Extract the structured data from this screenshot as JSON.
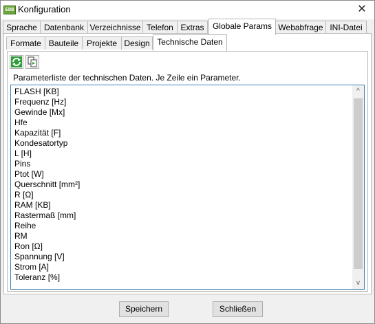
{
  "window": {
    "app_icon": "app-logo-icon",
    "title": "Konfiguration",
    "close_glyph": "✕"
  },
  "tabs": [
    "Sprache",
    "Datenbank",
    "Verzeichnisse",
    "Telefon",
    "Extras",
    "Globale Params",
    "Webabfrage",
    "INI-Datei"
  ],
  "active_tab": "Globale Params",
  "subtabs": [
    "Formate",
    "Bauteile",
    "Projekte",
    "Design",
    "Technische Daten"
  ],
  "active_subtab": "Technische Daten",
  "toolbar": {
    "refresh_icon": "refresh-icon",
    "copy_icon": "copy-icon"
  },
  "description": "Parameterliste der technischen Daten. Je Zeile ein Parameter.",
  "parameters": [
    "FLASH [KB]",
    "Frequenz [Hz]",
    "Gewinde [Mx]",
    "Hfe",
    "Kapazität [F]",
    "Kondesatortyp",
    "L [H]",
    "Pins",
    "Ptot [W]",
    "Querschnitt [mm²]",
    "R [Ω]",
    "RAM [KB]",
    "Rastermaß [mm]",
    "Reihe",
    "RM",
    "Ron [Ω]",
    "Spannung [V]",
    "Strom [A]",
    "Toleranz [%]"
  ],
  "scroll": {
    "up": "^",
    "down": "v"
  },
  "buttons": {
    "save": "Speichern",
    "close": "Schließen"
  },
  "colors": {
    "focus_border": "#3c7fb1",
    "refresh_green": "#2e9e3a"
  }
}
